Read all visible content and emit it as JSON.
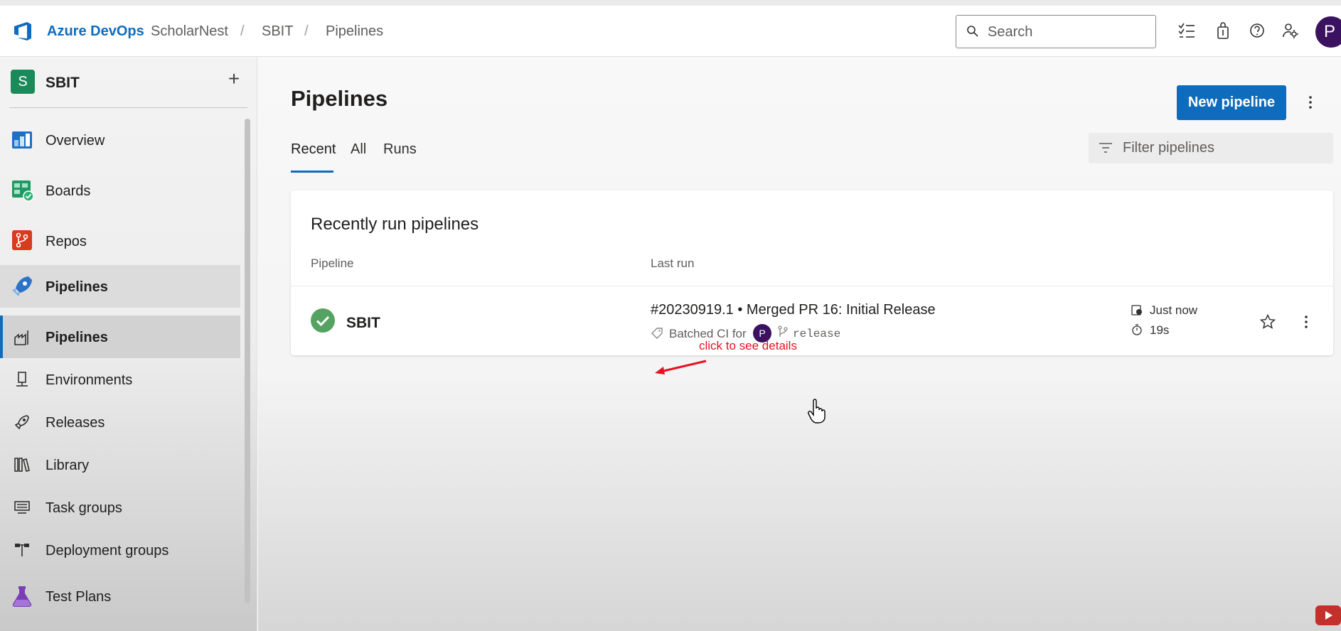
{
  "header": {
    "brand": "Azure DevOps",
    "breadcrumb": [
      "ScholarNest",
      "SBIT",
      "Pipelines"
    ],
    "search_placeholder": "Search",
    "user_initial": "P",
    "icons": [
      "task-list-icon",
      "shopping-bag-icon",
      "help-icon",
      "user-settings-icon"
    ]
  },
  "sidebar": {
    "project_initial": "S",
    "project_name": "SBIT",
    "add_label": "+",
    "items": [
      {
        "label": "Overview",
        "icon": "overview-icon"
      },
      {
        "label": "Boards",
        "icon": "boards-icon"
      },
      {
        "label": "Repos",
        "icon": "repos-icon"
      },
      {
        "label": "Pipelines",
        "icon": "pipelines-icon"
      }
    ],
    "sub_items": [
      {
        "label": "Pipelines",
        "icon": "pipelines-sub-icon"
      },
      {
        "label": "Environments",
        "icon": "environments-icon"
      },
      {
        "label": "Releases",
        "icon": "releases-icon"
      },
      {
        "label": "Library",
        "icon": "library-icon"
      },
      {
        "label": "Task groups",
        "icon": "task-groups-icon"
      },
      {
        "label": "Deployment groups",
        "icon": "deployment-groups-icon"
      }
    ],
    "bottom_item": {
      "label": "Test Plans",
      "icon": "test-plans-icon"
    }
  },
  "main": {
    "title": "Pipelines",
    "new_button": "New pipeline",
    "tabs": [
      "Recent",
      "All",
      "Runs"
    ],
    "active_tab": "Recent",
    "filter_placeholder": "Filter pipelines",
    "card": {
      "title": "Recently run pipelines",
      "columns": [
        "Pipeline",
        "Last run"
      ],
      "rows": [
        {
          "status": "succeeded",
          "name": "SBIT",
          "run_title": "#20230919.1 • Merged PR 16: Initial Release",
          "reason": "Batched CI for",
          "user_initial": "P",
          "branch": "release",
          "when": "Just now",
          "duration": "19s"
        }
      ]
    },
    "annotation": "click to see details"
  },
  "colors": {
    "accent": "#0f6cbd",
    "success": "#55a362",
    "annotation": "#e81123",
    "avatar": "#3b1260"
  }
}
